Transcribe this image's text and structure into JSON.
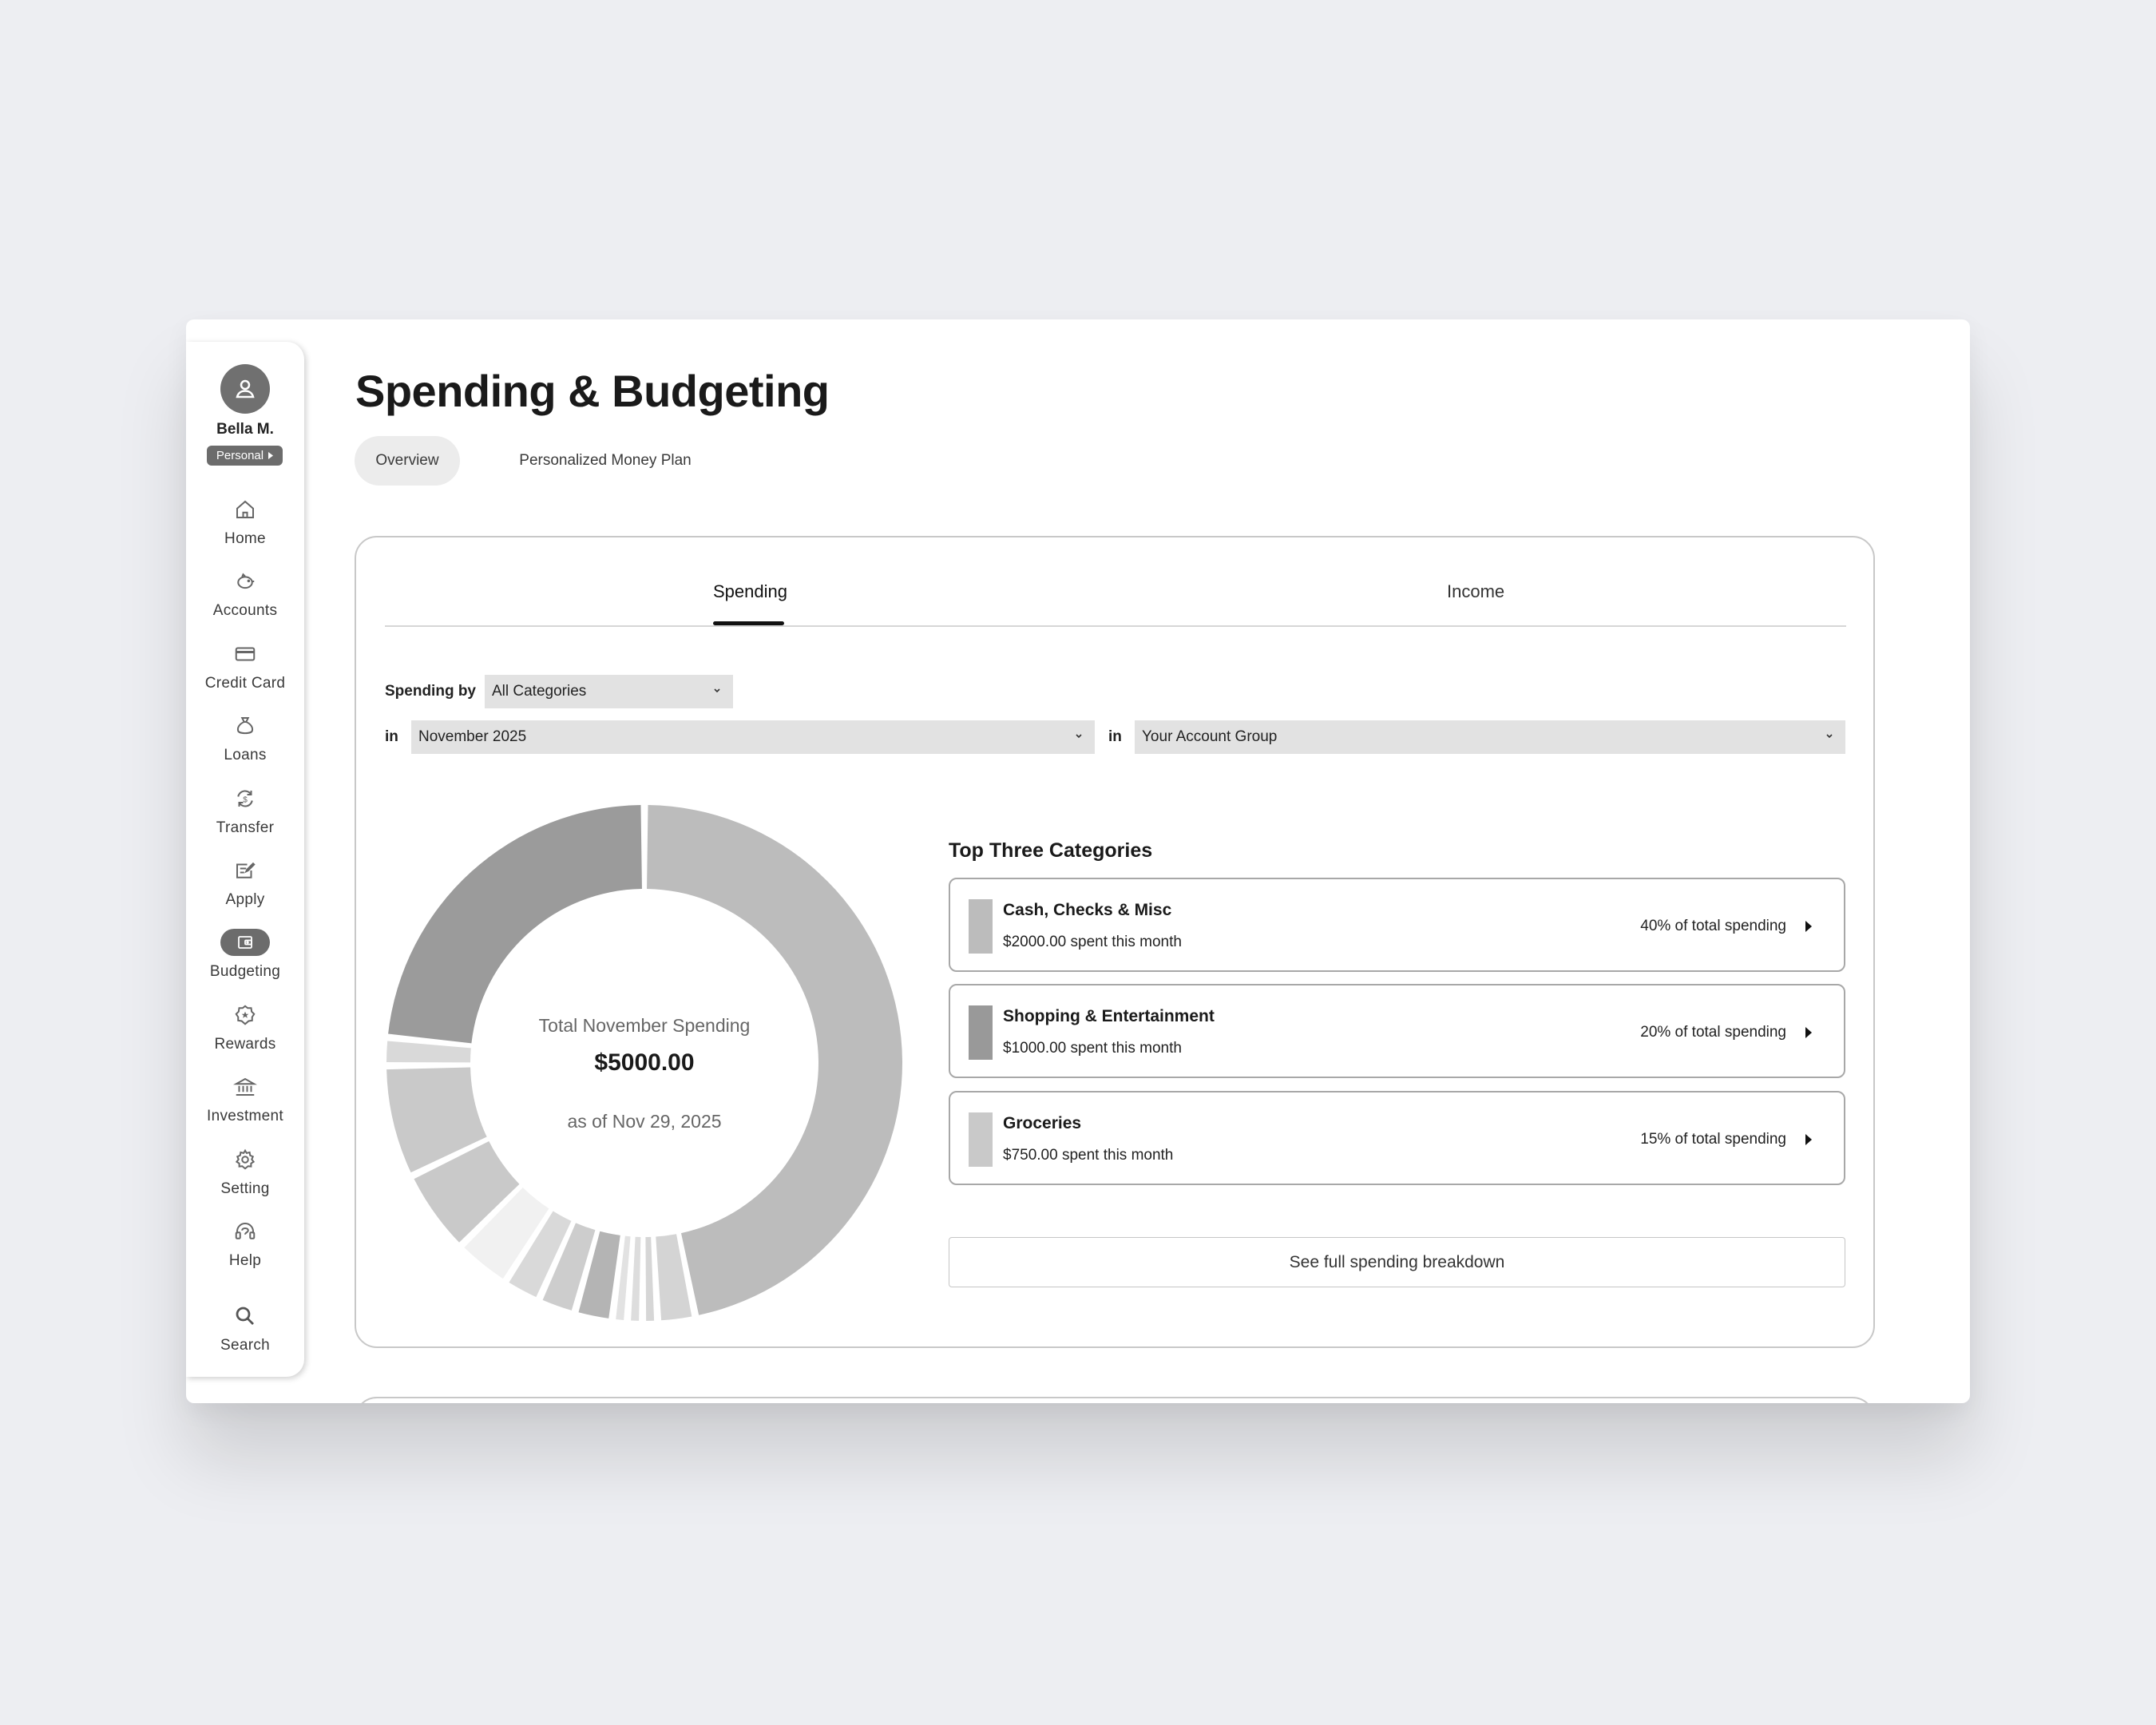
{
  "user": {
    "name": "Bella M.",
    "badge": "Personal"
  },
  "nav": [
    {
      "label": "Home",
      "icon": "home-icon"
    },
    {
      "label": "Accounts",
      "icon": "piggy-bank-icon"
    },
    {
      "label": "Credit Card",
      "icon": "credit-card-icon"
    },
    {
      "label": "Loans",
      "icon": "money-bag-icon"
    },
    {
      "label": "Transfer",
      "icon": "transfer-icon"
    },
    {
      "label": "Apply",
      "icon": "apply-icon"
    },
    {
      "label": "Budgeting",
      "icon": "wallet-icon",
      "active": true
    },
    {
      "label": "Rewards",
      "icon": "rewards-icon"
    },
    {
      "label": "Investment",
      "icon": "bank-icon"
    },
    {
      "label": "Setting",
      "icon": "gear-icon"
    },
    {
      "label": "Help",
      "icon": "headset-icon"
    },
    {
      "label": "Search",
      "icon": "search-icon"
    }
  ],
  "page": {
    "title": "Spending & Budgeting",
    "tabs": [
      {
        "label": "Overview",
        "active": true
      },
      {
        "label": "Personalized Money Plan"
      }
    ]
  },
  "segments": {
    "spending": "Spending",
    "income": "Income"
  },
  "filters": {
    "spending_by_label": "Spending by",
    "category": "All Categories",
    "in_label": "in",
    "month": "November 2025",
    "account_group": "Your Account Group"
  },
  "summary": {
    "label": "Total November Spending",
    "total": "$5000.00",
    "as_of": "as of Nov 29, 2025"
  },
  "top_categories": {
    "title": "Top Three Categories",
    "items": [
      {
        "name": "Cash, Checks & Misc",
        "amount": "$2000.00 spent this month",
        "percent": "40% of total spending",
        "color": "#bcbcbc"
      },
      {
        "name": "Shopping & Entertainment",
        "amount": "$1000.00 spent this month",
        "percent": "20% of total spending",
        "color": "#999999"
      },
      {
        "name": "Groceries",
        "amount": "$750.00 spent this month",
        "percent": "15% of total spending",
        "color": "#c9c9c9"
      }
    ]
  },
  "breakdown_button": "See full spending breakdown",
  "chart_data": {
    "type": "pie",
    "values": [
      40,
      2,
      0.8,
      0.8,
      0.8,
      2,
      2,
      2,
      3,
      4.5,
      6,
      1.5,
      20
    ],
    "colors": [
      "#bcbcbc",
      "#d4d4d4",
      "#d6d6d6",
      "#dddddd",
      "#e2e2e2",
      "#b4b4b4",
      "#cdcdcd",
      "#d9d9d9",
      "#f1f1f1",
      "#c9c9c9",
      "#c9c9c9",
      "#d9d9d9",
      "#9b9b9b"
    ]
  }
}
